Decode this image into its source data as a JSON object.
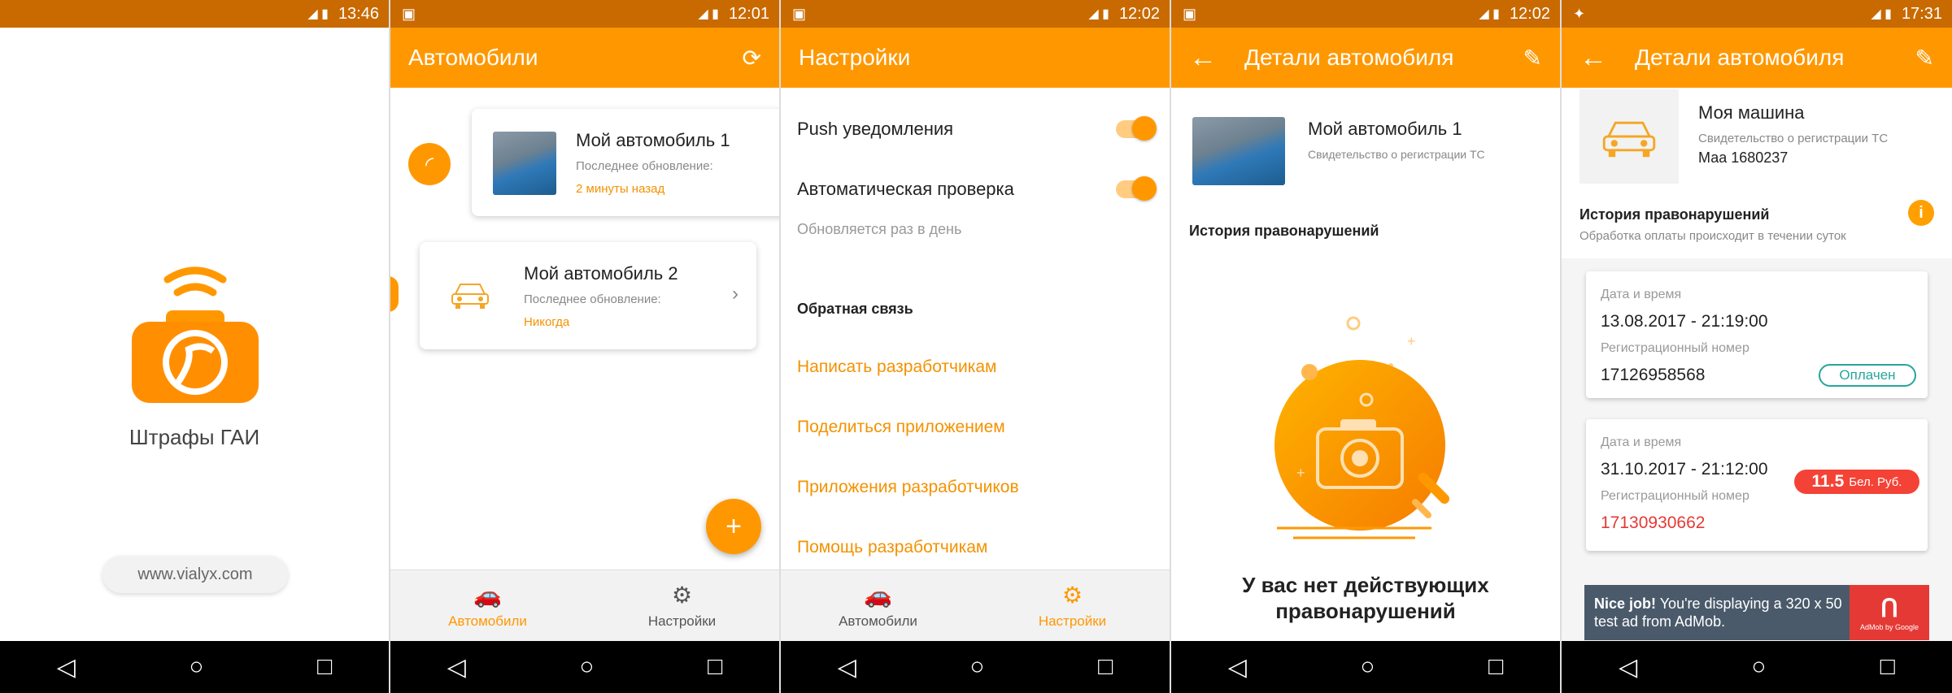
{
  "colors": {
    "primary": "#ff9800",
    "status": "#c96a00",
    "paid": "#26a69a",
    "fine": "#f44336"
  },
  "screen1": {
    "status_time": "13:46",
    "app_name": "Штрафы ГАИ",
    "website": "www.vialyx.com"
  },
  "screen2": {
    "status_time": "12:01",
    "title": "Автомобили",
    "cars": [
      {
        "name": "Мой автомобиль 1",
        "updated_label": "Последнее обновление:",
        "updated_value": "2 минуты назад"
      },
      {
        "name": "Мой автомобиль 2",
        "updated_label": "Последнее обновление:",
        "updated_value": "Никогда"
      }
    ],
    "tabs": [
      {
        "label": "Автомобили"
      },
      {
        "label": "Настройки"
      }
    ]
  },
  "screen3": {
    "status_time": "12:02",
    "title": "Настройки",
    "push_label": "Push уведомления",
    "auto_label": "Автоматическая проверка",
    "auto_hint": "Обновляется раз в день",
    "feedback_title": "Обратная связь",
    "links": [
      "Написать разработчикам",
      "Поделиться приложением",
      "Приложения разработчиков",
      "Помощь разработчикам"
    ],
    "tabs": [
      {
        "label": "Автомобили"
      },
      {
        "label": "Настройки"
      }
    ]
  },
  "screen4": {
    "status_time": "12:02",
    "title": "Детали автомобиля",
    "car_name": "Мой автомобиль 1",
    "car_sub": "Свидетельство о регистрации ТС",
    "history_title": "История правонарушений",
    "empty_line1": "У вас нет действующих",
    "empty_line2": "правонарушений"
  },
  "screen5": {
    "status_time": "17:31",
    "title": "Детали автомобиля",
    "car_name": "Моя машина",
    "car_sub": "Свидетельство о регистрации ТС",
    "car_reg": "Маа 1680237",
    "history_title": "История правонарушений",
    "history_sub": "Обработка оплаты происходит в течении суток",
    "fines": [
      {
        "date_label": "Дата и время",
        "date": "13.08.2017 - 21:19:00",
        "reg_label": "Регистрационный номер",
        "reg": "17126958568",
        "status": "Оплачен"
      },
      {
        "date_label": "Дата и время",
        "date": "31.10.2017 - 21:12:00",
        "reg_label": "Регистрационный номер",
        "reg": "17130930662",
        "amount": "11.5",
        "currency": "Бел. Руб."
      }
    ],
    "ad_bold": "Nice job!",
    "ad_text": "You're displaying a 320 x 50 test ad from AdMob.",
    "ad_by": "AdMob by Google"
  }
}
